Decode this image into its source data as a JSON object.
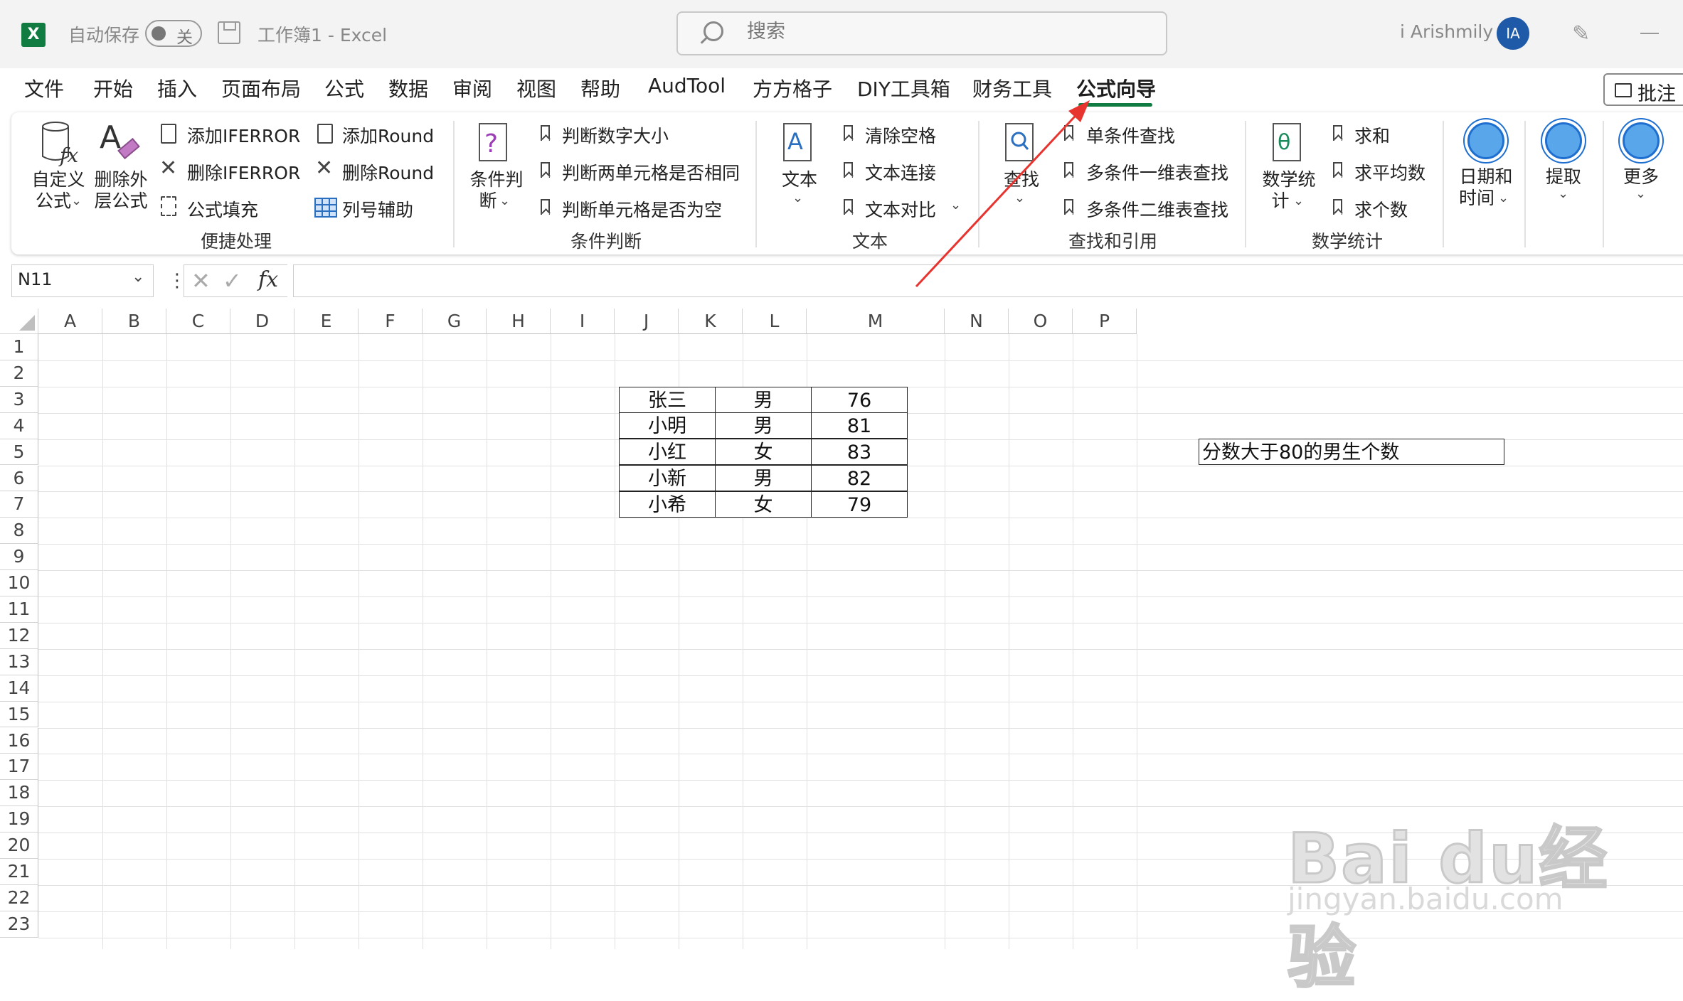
{
  "titlebar": {
    "logo": "X",
    "autosave_label": "自动保存",
    "autosave_state": "关",
    "doc_title": "工作簿1  -  Excel",
    "search_placeholder": "搜索",
    "username": "i Arishmily",
    "avatar_initials": "IA"
  },
  "menu": {
    "tabs": [
      "文件",
      "开始",
      "插入",
      "页面布局",
      "公式",
      "数据",
      "审阅",
      "视图",
      "帮助",
      "AudTool",
      "方方格子",
      "DIY工具箱",
      "财务工具",
      "公式向导"
    ],
    "active_tab": "公式向导",
    "comment_button": "批注"
  },
  "ribbon": {
    "quick": {
      "custom_formula_l1": "自定义",
      "custom_formula_l2": "公式",
      "delete_outer_l1": "删除外",
      "delete_outer_l2": "层公式",
      "add_iferror": "添加IFERROR",
      "remove_iferror": "删除IFERROR",
      "formula_fill": "公式填充",
      "add_round": "添加Round",
      "remove_round": "删除Round",
      "col_helper": "列号辅助",
      "group_label": "便捷处理"
    },
    "condition": {
      "big_l1": "条件判",
      "big_l2": "断",
      "item1": "判断数字大小",
      "item2": "判断两单元格是否相同",
      "item3": "判断单元格是否为空",
      "group_label": "条件判断"
    },
    "text": {
      "big": "文本",
      "item1": "清除空格",
      "item2": "文本连接",
      "item3": "文本对比",
      "group_label": "文本"
    },
    "lookup": {
      "big": "查找",
      "item1": "单条件查找",
      "item2": "多条件一维表查找",
      "item3": "多条件二维表查找",
      "group_label": "查找和引用"
    },
    "math": {
      "big_l1": "数学统",
      "big_l2": "计",
      "item1": "求和",
      "item2": "求平均数",
      "item3": "求个数",
      "group_label": "数学统计"
    },
    "datetime_l1": "日期和",
    "datetime_l2": "时间",
    "extract": "提取",
    "more": "更多"
  },
  "formula_bar": {
    "name_box": "N11",
    "formula": ""
  },
  "sheet": {
    "columns": [
      "A",
      "B",
      "C",
      "D",
      "E",
      "F",
      "G",
      "H",
      "I",
      "J",
      "K",
      "L",
      "M",
      "N",
      "O",
      "P"
    ],
    "rows": [
      "1",
      "2",
      "3",
      "4",
      "5",
      "6",
      "7",
      "8",
      "9",
      "10",
      "11",
      "12",
      "13",
      "14",
      "15",
      "16",
      "17",
      "18",
      "19",
      "20",
      "21",
      "22",
      "23"
    ],
    "table": [
      [
        "张三",
        "男",
        "76"
      ],
      [
        "小明",
        "男",
        "81"
      ],
      [
        "小红",
        "女",
        "83"
      ],
      [
        "小新",
        "男",
        "82"
      ],
      [
        "小希",
        "女",
        "79"
      ]
    ],
    "note": "分数大于80的男生个数"
  },
  "watermark": {
    "main": "Bai du经验",
    "sub": "jingyan.baidu.com"
  },
  "colors": {
    "excel_green": "#107c41",
    "arrow_red": "#e8342f",
    "avatar_blue": "#1f5aa8"
  }
}
